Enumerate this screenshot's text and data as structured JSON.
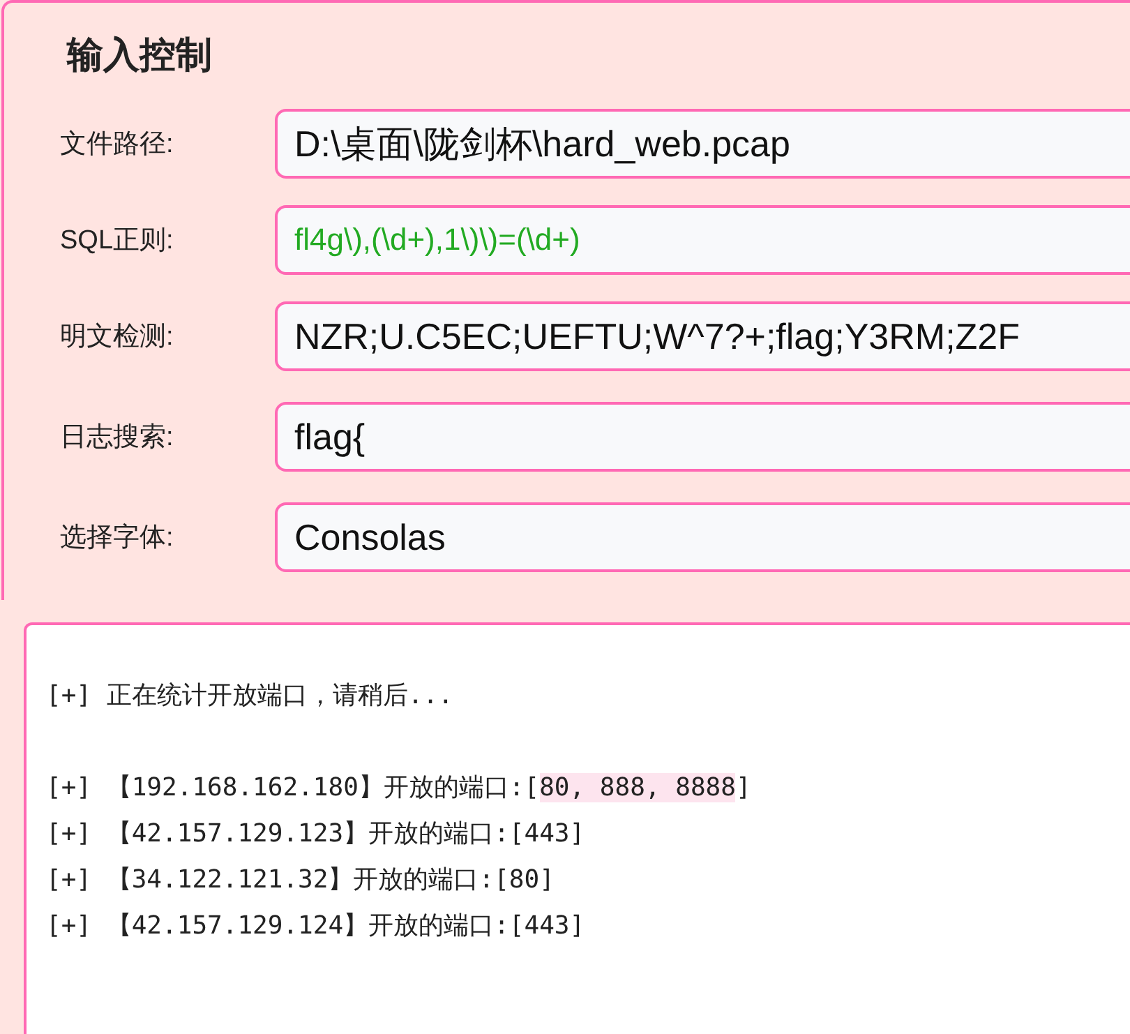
{
  "panel": {
    "title": "输入控制",
    "fields": [
      {
        "label": "文件路径:",
        "value": "D:\\桌面\\陇剑杯\\hard_web.pcap",
        "kind": "text"
      },
      {
        "label": "SQL正则:",
        "value": "fl4g\\),(\\d+),1\\)\\)=(\\d+)",
        "kind": "regex"
      },
      {
        "label": "明文检测:",
        "value": "NZR;U.C5EC;UEFTU;W^7?+;flag;Y3RM;Z2F",
        "kind": "text"
      },
      {
        "label": "日志搜索:",
        "value": "flag{",
        "kind": "text"
      },
      {
        "label": "选择字体:",
        "value": "Consolas",
        "kind": "text"
      }
    ]
  },
  "log": {
    "lines": [
      {
        "text": "[+] 正在统计开放端口，请稍后..."
      },
      {
        "text": "[+] 【192.168.162.180】开放的端口:[",
        "selection": "80, 888, 8888",
        "after": "]",
        "spaced": true
      },
      {
        "text": "[+] 【42.157.129.123】开放的端口:[443]"
      },
      {
        "text": "[+] 【34.122.121.32】开放的端口:[80]"
      },
      {
        "text": "[+] 【42.157.129.124】开放的端口:[443]"
      }
    ]
  }
}
